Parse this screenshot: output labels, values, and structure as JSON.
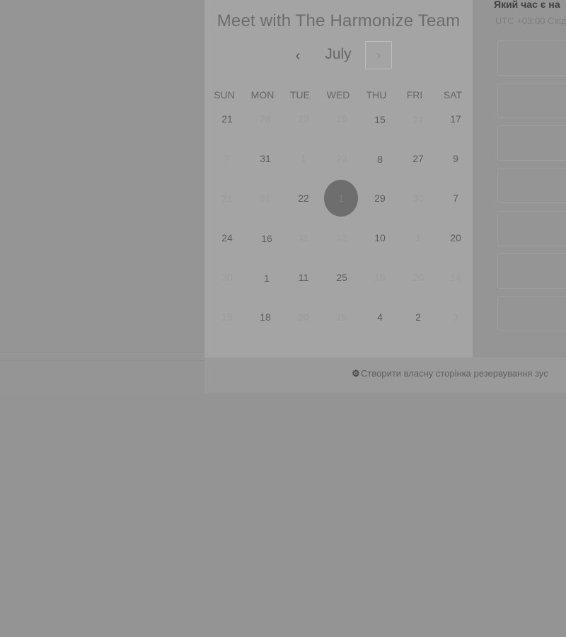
{
  "calendar": {
    "title": "Meet with The Harmonize Team",
    "month": "July",
    "prev_icon": "chevron-left-icon",
    "next_icon": "chevron-right-icon",
    "prev_glyph": "‹",
    "next_glyph": "›",
    "weekdays": [
      "SUN",
      "MON",
      "TUE",
      "WED",
      "THU",
      "FRI",
      "SAT"
    ],
    "rows": [
      [
        "21",
        "28",
        "13",
        "10",
        "15",
        "24",
        "17"
      ],
      [
        "7",
        "31",
        "1",
        "23",
        "8",
        "27",
        "9"
      ],
      [
        "21",
        "31",
        "22",
        "1",
        "29",
        "30",
        "7"
      ],
      [
        "24",
        "16",
        "11",
        "12",
        "10",
        "1",
        "20"
      ],
      [
        "30",
        "1",
        "11",
        "25",
        "15",
        "20",
        "14"
      ],
      [
        "15",
        "18",
        "20",
        "19",
        "4",
        "2",
        "3"
      ]
    ],
    "selected_day": "1"
  },
  "right_panel": {
    "title": "Який час є на",
    "timezone": "UTC +03:00 Схід"
  },
  "footer": {
    "link_icon": "sprocket-icon",
    "link_text": "Створити власну сторінка резервування зус"
  }
}
